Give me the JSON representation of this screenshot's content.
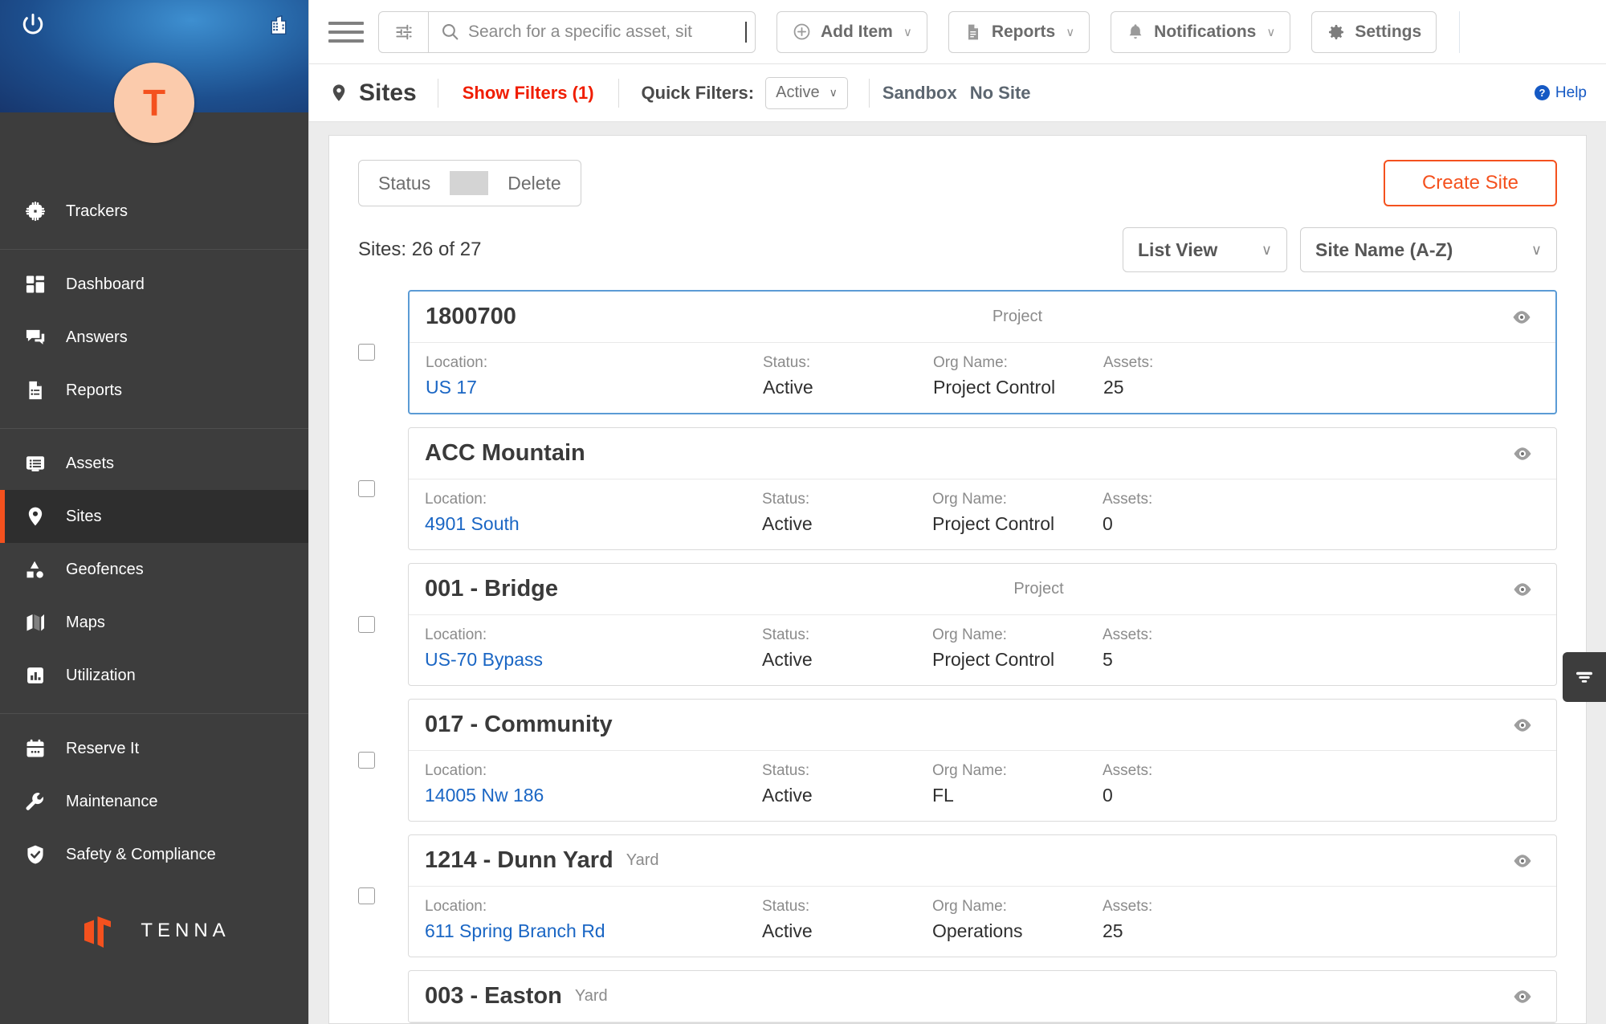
{
  "sidebar": {
    "power_icon": "power-icon",
    "building_icon": "building-icon",
    "avatar_initial": "T",
    "groups": [
      {
        "items": [
          {
            "label": "Trackers",
            "icon": "chip-icon",
            "active": false
          }
        ]
      },
      {
        "items": [
          {
            "label": "Dashboard",
            "icon": "dashboard-icon",
            "active": false
          },
          {
            "label": "Answers",
            "icon": "chat-icon",
            "active": false
          },
          {
            "label": "Reports",
            "icon": "document-icon",
            "active": false
          }
        ]
      },
      {
        "items": [
          {
            "label": "Assets",
            "icon": "list-card-icon",
            "active": false
          },
          {
            "label": "Sites",
            "icon": "map-pin-icon",
            "active": true
          },
          {
            "label": "Geofences",
            "icon": "shapes-icon",
            "active": false
          },
          {
            "label": "Maps",
            "icon": "map-icon",
            "active": false
          },
          {
            "label": "Utilization",
            "icon": "bar-chart-icon",
            "active": false
          }
        ]
      },
      {
        "items": [
          {
            "label": "Reserve It",
            "icon": "calendar-icon",
            "active": false
          },
          {
            "label": "Maintenance",
            "icon": "wrench-icon",
            "active": false
          },
          {
            "label": "Safety & Compliance",
            "icon": "shield-check-icon",
            "active": false
          }
        ]
      }
    ],
    "logo_text": "TENNA"
  },
  "topbar": {
    "menu_icon": "hamburger-icon",
    "advanced_search_icon": "filter-sliders-icon",
    "search_icon": "search-icon",
    "search_placeholder": "Search for a specific asset, sit",
    "search_value": "",
    "buttons": [
      {
        "label": "Add Item",
        "icon": "plus-circle-icon",
        "chevron": "∨"
      },
      {
        "label": "Reports",
        "icon": "document-icon",
        "chevron": "∨"
      },
      {
        "label": "Notifications",
        "icon": "bell-icon",
        "chevron": "∨"
      },
      {
        "label": "Settings",
        "icon": "gear-icon",
        "chevron": ""
      }
    ]
  },
  "page_header": {
    "pin_icon": "map-pin-icon",
    "title": "Sites",
    "show_filters": "Show Filters (1)",
    "quick_filters_label": "Quick Filters:",
    "quick_filter_value": "Active",
    "quick_filter_chevron": "∨",
    "chips": [
      "Sandbox",
      "No Site"
    ],
    "help_label": "Help",
    "help_icon": "question-circle-icon"
  },
  "toolbar": {
    "status_label": "Status",
    "delete_label": "Delete",
    "create_label": "Create Site",
    "count_label": "Sites: 26 of 27",
    "view_select": "List View",
    "sort_select": "Site Name (A-Z)",
    "chevron": "∨"
  },
  "labels": {
    "location": "Location:",
    "status": "Status:",
    "org_name": "Org Name:",
    "assets": "Assets:",
    "eye_icon": "eye-icon",
    "checkbox": "row-checkbox"
  },
  "filter_tab": {
    "icon": "filter-icon"
  },
  "sites": [
    {
      "name": "1800700",
      "type": "Project",
      "location": "US 17",
      "status": "Active",
      "org": "Project Control",
      "assets": "25",
      "selected": true
    },
    {
      "name": "ACC Mountain",
      "type": "",
      "location": "4901 South",
      "status": "Active",
      "org": "Project Control",
      "assets": "0",
      "selected": false
    },
    {
      "name": "001 - Bridge",
      "type": "Project",
      "location": "US-70 Bypass",
      "status": "Active",
      "org": "Project Control",
      "assets": "5",
      "selected": false
    },
    {
      "name": "017 - Community",
      "type": "",
      "location": "14005 Nw 186",
      "status": "Active",
      "org": "FL",
      "assets": "0",
      "selected": false
    },
    {
      "name": "1214 - Dunn Yard",
      "type": "Yard",
      "location": "611 Spring Branch Rd",
      "status": "Active",
      "org": "Operations",
      "assets": "25",
      "selected": false
    },
    {
      "name": "003 - Easton",
      "type": "Yard",
      "location": "",
      "status": "",
      "org": "",
      "assets": "",
      "selected": false
    }
  ]
}
